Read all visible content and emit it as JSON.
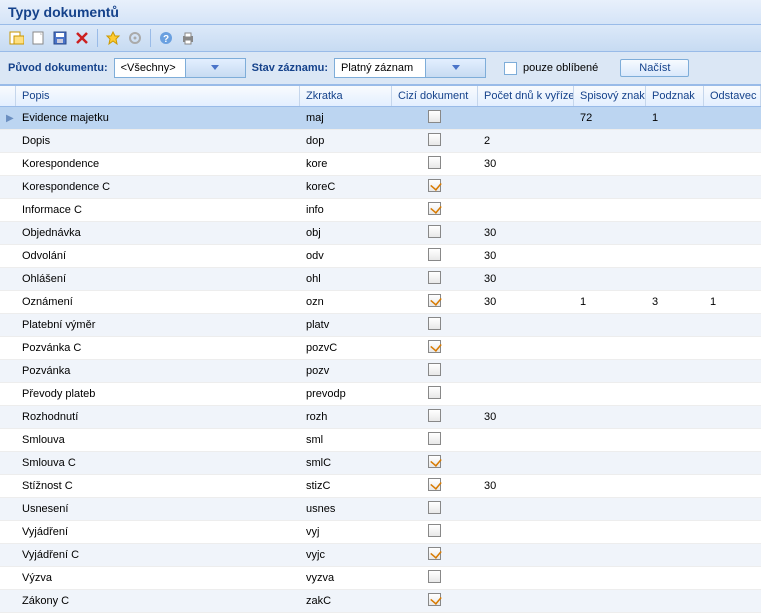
{
  "header": {
    "title": "Typy dokumentů"
  },
  "filter": {
    "origin_label": "Původ dokumentu:",
    "origin_value": "<Všechny>",
    "state_label": "Stav záznamu:",
    "state_value": "Platný záznam",
    "favorites_label": "pouze oblíbené",
    "load_btn": "Načíst"
  },
  "columns": {
    "popis": "Popis",
    "zkratka": "Zkratka",
    "cizi": "Cizí dokument",
    "dnu": "Počet dnů k vyříze",
    "spis": "Spisový znak",
    "podznak": "Podznak",
    "odstavec": "Odstavec"
  },
  "rows": [
    {
      "popis": "Evidence majetku",
      "zkratka": "maj",
      "cizi": false,
      "dnu": "",
      "spis": "72",
      "podznak": "1",
      "odstavec": "",
      "selected": true
    },
    {
      "popis": "Dopis",
      "zkratka": "dop",
      "cizi": false,
      "dnu": "2",
      "spis": "",
      "podznak": "",
      "odstavec": ""
    },
    {
      "popis": "Korespondence",
      "zkratka": "kore",
      "cizi": false,
      "dnu": "30",
      "spis": "",
      "podznak": "",
      "odstavec": ""
    },
    {
      "popis": "Korespondence C",
      "zkratka": "koreC",
      "cizi": true,
      "dnu": "",
      "spis": "",
      "podznak": "",
      "odstavec": ""
    },
    {
      "popis": "Informace C",
      "zkratka": "info",
      "cizi": true,
      "dnu": "",
      "spis": "",
      "podznak": "",
      "odstavec": ""
    },
    {
      "popis": "Objednávka",
      "zkratka": "obj",
      "cizi": false,
      "dnu": "30",
      "spis": "",
      "podznak": "",
      "odstavec": ""
    },
    {
      "popis": "Odvolání",
      "zkratka": "odv",
      "cizi": false,
      "dnu": "30",
      "spis": "",
      "podznak": "",
      "odstavec": ""
    },
    {
      "popis": "Ohlášení",
      "zkratka": "ohl",
      "cizi": false,
      "dnu": "30",
      "spis": "",
      "podznak": "",
      "odstavec": ""
    },
    {
      "popis": "Oznámení",
      "zkratka": "ozn",
      "cizi": true,
      "dnu": "30",
      "spis": "1",
      "podznak": "3",
      "odstavec": "1"
    },
    {
      "popis": "Platební výměr",
      "zkratka": "platv",
      "cizi": false,
      "dnu": "",
      "spis": "",
      "podznak": "",
      "odstavec": ""
    },
    {
      "popis": "Pozvánka C",
      "zkratka": "pozvC",
      "cizi": true,
      "dnu": "",
      "spis": "",
      "podznak": "",
      "odstavec": ""
    },
    {
      "popis": "Pozvánka",
      "zkratka": "pozv",
      "cizi": false,
      "dnu": "",
      "spis": "",
      "podznak": "",
      "odstavec": ""
    },
    {
      "popis": "Převody plateb",
      "zkratka": "prevodp",
      "cizi": false,
      "dnu": "",
      "spis": "",
      "podznak": "",
      "odstavec": ""
    },
    {
      "popis": "Rozhodnutí",
      "zkratka": "rozh",
      "cizi": false,
      "dnu": "30",
      "spis": "",
      "podznak": "",
      "odstavec": ""
    },
    {
      "popis": "Smlouva",
      "zkratka": "sml",
      "cizi": false,
      "dnu": "",
      "spis": "",
      "podznak": "",
      "odstavec": ""
    },
    {
      "popis": "Smlouva C",
      "zkratka": "smlC",
      "cizi": true,
      "dnu": "",
      "spis": "",
      "podznak": "",
      "odstavec": ""
    },
    {
      "popis": "Stížnost C",
      "zkratka": "stizC",
      "cizi": true,
      "dnu": "30",
      "spis": "",
      "podznak": "",
      "odstavec": ""
    },
    {
      "popis": "Usnesení",
      "zkratka": "usnes",
      "cizi": false,
      "dnu": "",
      "spis": "",
      "podznak": "",
      "odstavec": ""
    },
    {
      "popis": "Vyjádření",
      "zkratka": "vyj",
      "cizi": false,
      "dnu": "",
      "spis": "",
      "podznak": "",
      "odstavec": ""
    },
    {
      "popis": "Vyjádření C",
      "zkratka": "vyjc",
      "cizi": true,
      "dnu": "",
      "spis": "",
      "podznak": "",
      "odstavec": ""
    },
    {
      "popis": "Výzva",
      "zkratka": "vyzva",
      "cizi": false,
      "dnu": "",
      "spis": "",
      "podznak": "",
      "odstavec": ""
    },
    {
      "popis": "Zákony C",
      "zkratka": "zakC",
      "cizi": true,
      "dnu": "",
      "spis": "",
      "podznak": "",
      "odstavec": ""
    }
  ]
}
